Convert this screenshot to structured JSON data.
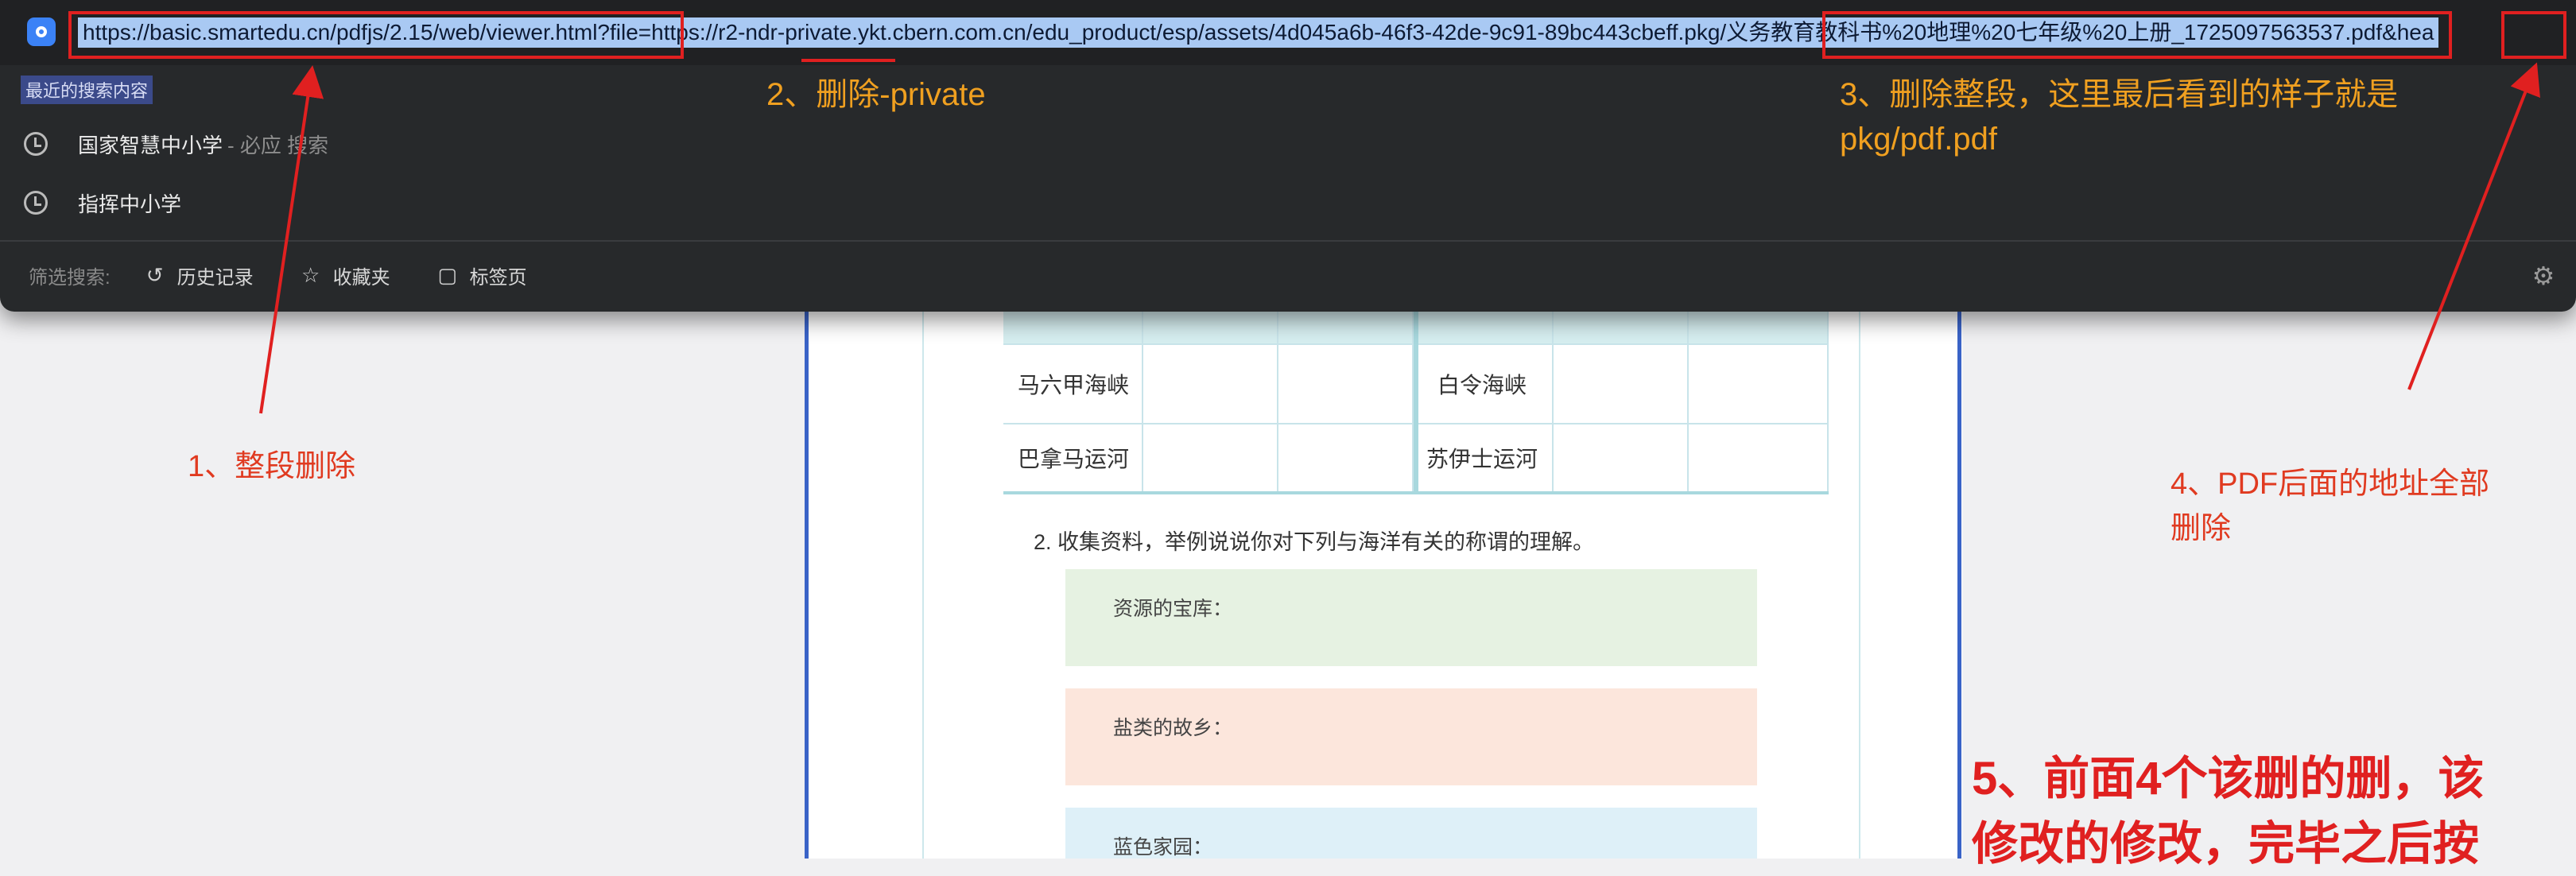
{
  "browser": {
    "url": "https://basic.smartedu.cn/pdfjs/2.15/web/viewer.html?file=https://r2-ndr-private.ykt.cbern.com.cn/edu_product/esp/assets/4d045a6b-46f3-42de-9c91-89bc443cbeff.pkg/义务教育教科书%20地理%20七年级%20上册_1725097563537.pdf&hea",
    "recent_label": "最近的搜索内容",
    "suggestions": [
      {
        "text": "国家智慧中小学",
        "sub": "- 必应 搜索"
      },
      {
        "text": "指挥中小学",
        "sub": ""
      }
    ],
    "filter_label": "筛选搜索:",
    "filters": [
      "历史记录",
      "收藏夹",
      "标签页"
    ]
  },
  "annotations": {
    "step1": "1、整段删除",
    "step2": "2、删除-private",
    "step3_line1": "3、删除整段，这里最后看到的样子就是",
    "step3_line2": "pkg/pdf.pdf",
    "step4_line1": "4、PDF后面的地址全部",
    "step4_line2": "删除",
    "step5_line1": "5、前面4个该删的删，该",
    "step5_line2": "修改的修改，完毕之后按"
  },
  "pdf": {
    "table_rows": [
      {
        "left": "马六甲海峡",
        "right": "白令海峡"
      },
      {
        "left": "巴拿马运河",
        "right": "苏伊士运河"
      }
    ],
    "question": "2. 收集资料，举例说说你对下列与海洋有关的称谓的理解。",
    "boxes": [
      {
        "label": "资源的宝库：",
        "color": "#e6f2e2"
      },
      {
        "label": "盐类的故乡：",
        "color": "#fce6dc"
      },
      {
        "label": "蓝色家园：",
        "color": "#def0f8"
      }
    ]
  }
}
